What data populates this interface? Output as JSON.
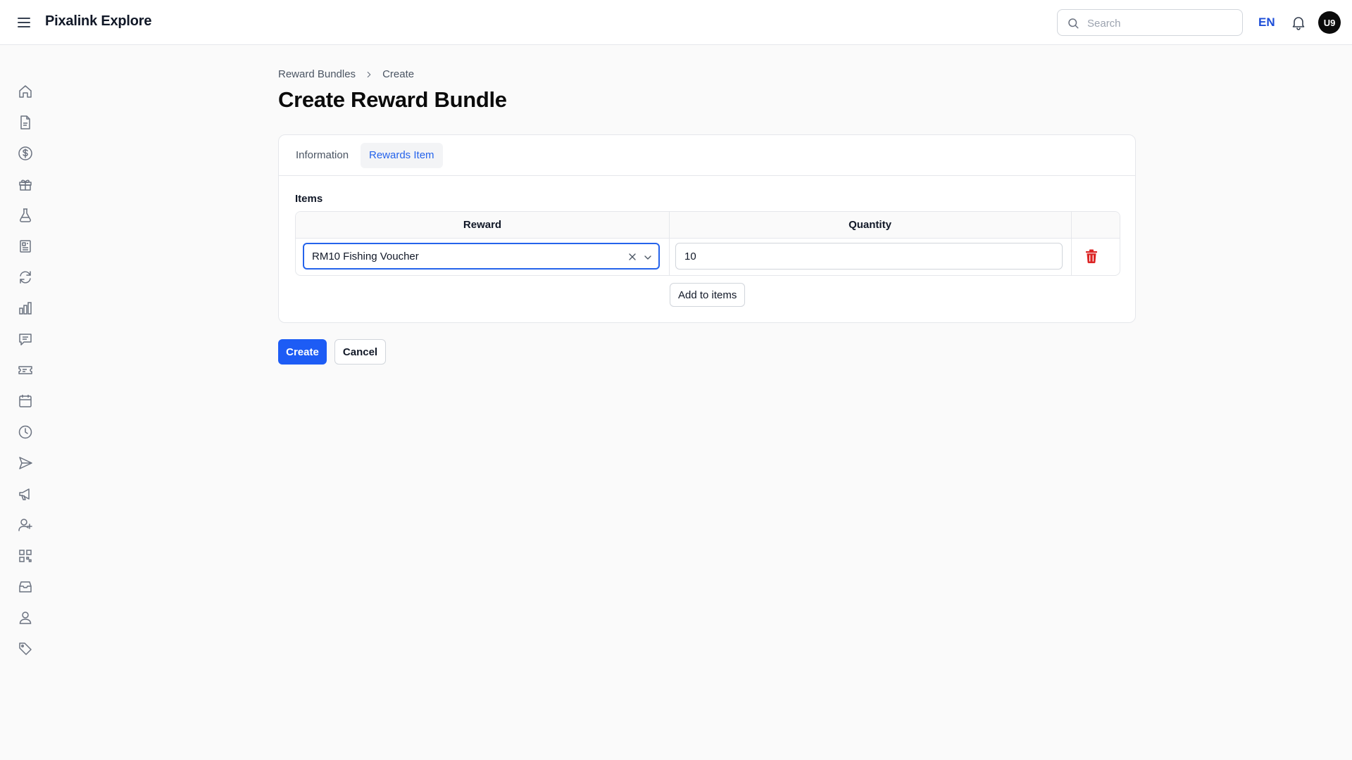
{
  "app": {
    "title": "Pixalink Explore"
  },
  "header": {
    "search_placeholder": "Search",
    "search_value": "",
    "language": "EN",
    "avatar_initials": "U9"
  },
  "sidebar": {
    "items": [
      {
        "icon": "home-icon"
      },
      {
        "icon": "document-icon"
      },
      {
        "icon": "dollar-icon"
      },
      {
        "icon": "gift-icon"
      },
      {
        "icon": "flask-icon"
      },
      {
        "icon": "newspaper-icon"
      },
      {
        "icon": "refresh-icon"
      },
      {
        "icon": "bar-chart-icon"
      },
      {
        "icon": "message-icon"
      },
      {
        "icon": "ticket-icon"
      },
      {
        "icon": "calendar-icon"
      },
      {
        "icon": "clock-icon"
      },
      {
        "icon": "send-icon"
      },
      {
        "icon": "megaphone-icon"
      },
      {
        "icon": "user-plus-icon"
      },
      {
        "icon": "qr-code-icon"
      },
      {
        "icon": "inbox-icon"
      },
      {
        "icon": "user-icon"
      },
      {
        "icon": "tag-icon"
      }
    ]
  },
  "breadcrumb": {
    "parent": "Reward Bundles",
    "current": "Create"
  },
  "page": {
    "title": "Create Reward Bundle"
  },
  "tabs": [
    {
      "label": "Information",
      "active": false
    },
    {
      "label": "Rewards Item",
      "active": true
    }
  ],
  "items_section": {
    "label": "Items",
    "columns": {
      "reward": "Reward",
      "quantity": "Quantity"
    },
    "rows": [
      {
        "reward": "RM10 Fishing Voucher",
        "quantity": "10"
      }
    ],
    "add_label": "Add to items"
  },
  "actions": {
    "create": "Create",
    "cancel": "Cancel"
  },
  "colors": {
    "primary": "#1d5cf5",
    "link": "#2563eb",
    "danger": "#dc2626",
    "background": "#fafafa"
  }
}
